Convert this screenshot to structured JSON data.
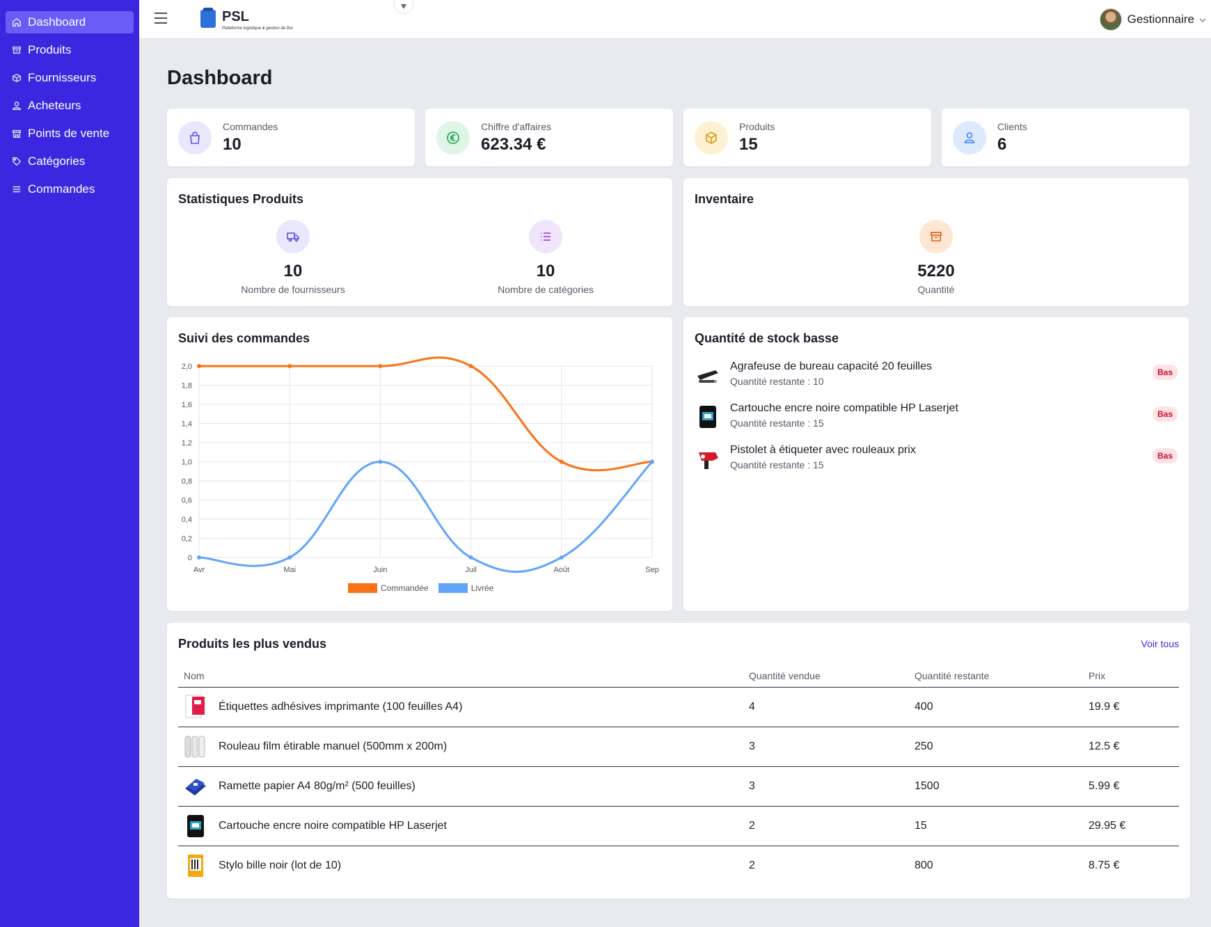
{
  "sidebar": {
    "items": [
      {
        "label": "Dashboard",
        "icon": "home-icon"
      },
      {
        "label": "Produits",
        "icon": "archive-icon"
      },
      {
        "label": "Fournisseurs",
        "icon": "cube-icon"
      },
      {
        "label": "Acheteurs",
        "icon": "user-icon"
      },
      {
        "label": "Points de vente",
        "icon": "store-icon"
      },
      {
        "label": "Catégories",
        "icon": "tag-icon"
      },
      {
        "label": "Commandes",
        "icon": "list-icon"
      }
    ]
  },
  "topbar": {
    "brand": "PSL",
    "tagline": "Plateforme logistique & gestion de flux",
    "user_name": "Gestionnaire"
  },
  "page_title": "Dashboard",
  "stats": [
    {
      "label": "Commandes",
      "value": "10",
      "icon": "shopping-bag-icon",
      "color": "#5b50e6",
      "bg": "#e9e7fd"
    },
    {
      "label": "Chiffre d'affaires",
      "value": "623.34 €",
      "icon": "euro-icon",
      "color": "#16a34a",
      "bg": "#dff5e7"
    },
    {
      "label": "Produits",
      "value": "15",
      "icon": "cube-icon",
      "color": "#d99a0b",
      "bg": "#fdf1d2"
    },
    {
      "label": "Clients",
      "value": "6",
      "icon": "user-icon",
      "color": "#3b82f6",
      "bg": "#dde9fd"
    }
  ],
  "product_stats": {
    "title": "Statistiques Produits",
    "suppliers_value": "10",
    "suppliers_label": "Nombre de fournisseurs",
    "categories_value": "10",
    "categories_label": "Nombre de catégories"
  },
  "inventory": {
    "title": "Inventaire",
    "value": "5220",
    "label": "Quantité"
  },
  "orders_chart": {
    "title": "Suivi des commandes"
  },
  "chart_data": {
    "type": "line",
    "categories": [
      "Avr",
      "Mai",
      "Juin",
      "Juil",
      "Août",
      "Sep"
    ],
    "series": [
      {
        "name": "Commandée",
        "values": [
          2,
          2,
          2,
          2,
          1,
          1
        ],
        "color": "#f97316"
      },
      {
        "name": "Livrée",
        "values": [
          0,
          0,
          1,
          0,
          0,
          1
        ],
        "color": "#60a5fa"
      }
    ],
    "ylim": [
      0,
      2
    ],
    "yticks": [
      "0",
      "0,2",
      "0,4",
      "0,6",
      "0,8",
      "1,0",
      "1,2",
      "1,4",
      "1,6",
      "1,8",
      "2,0"
    ],
    "grid": true,
    "legend": "bottom"
  },
  "low_stock": {
    "title": "Quantité de stock basse",
    "items": [
      {
        "name": "Agrafeuse de bureau capacité 20 feuilles",
        "qty": "Quantité restante : 10",
        "badge": "Bas"
      },
      {
        "name": "Cartouche encre noire compatible HP Laserjet",
        "qty": "Quantité restante : 15",
        "badge": "Bas"
      },
      {
        "name": "Pistolet à étiqueter avec rouleaux prix",
        "qty": "Quantité restante : 15",
        "badge": "Bas"
      }
    ]
  },
  "best_sellers": {
    "title": "Produits les plus vendus",
    "view_all": "Voir tous",
    "columns": [
      "Nom",
      "Quantité vendue",
      "Quantité restante",
      "Prix"
    ],
    "rows": [
      {
        "name": "Étiquettes adhésives imprimante (100 feuilles A4)",
        "sold": "4",
        "remaining": "400",
        "price": "19.9 €"
      },
      {
        "name": "Rouleau film étirable manuel (500mm x 200m)",
        "sold": "3",
        "remaining": "250",
        "price": "12.5 €"
      },
      {
        "name": "Ramette papier A4 80g/m² (500 feuilles)",
        "sold": "3",
        "remaining": "1500",
        "price": "5.99 €"
      },
      {
        "name": "Cartouche encre noire compatible HP Laserjet",
        "sold": "2",
        "remaining": "15",
        "price": "29.95 €"
      },
      {
        "name": "Stylo bille noir (lot de 10)",
        "sold": "2",
        "remaining": "800",
        "price": "8.75 €"
      }
    ]
  }
}
